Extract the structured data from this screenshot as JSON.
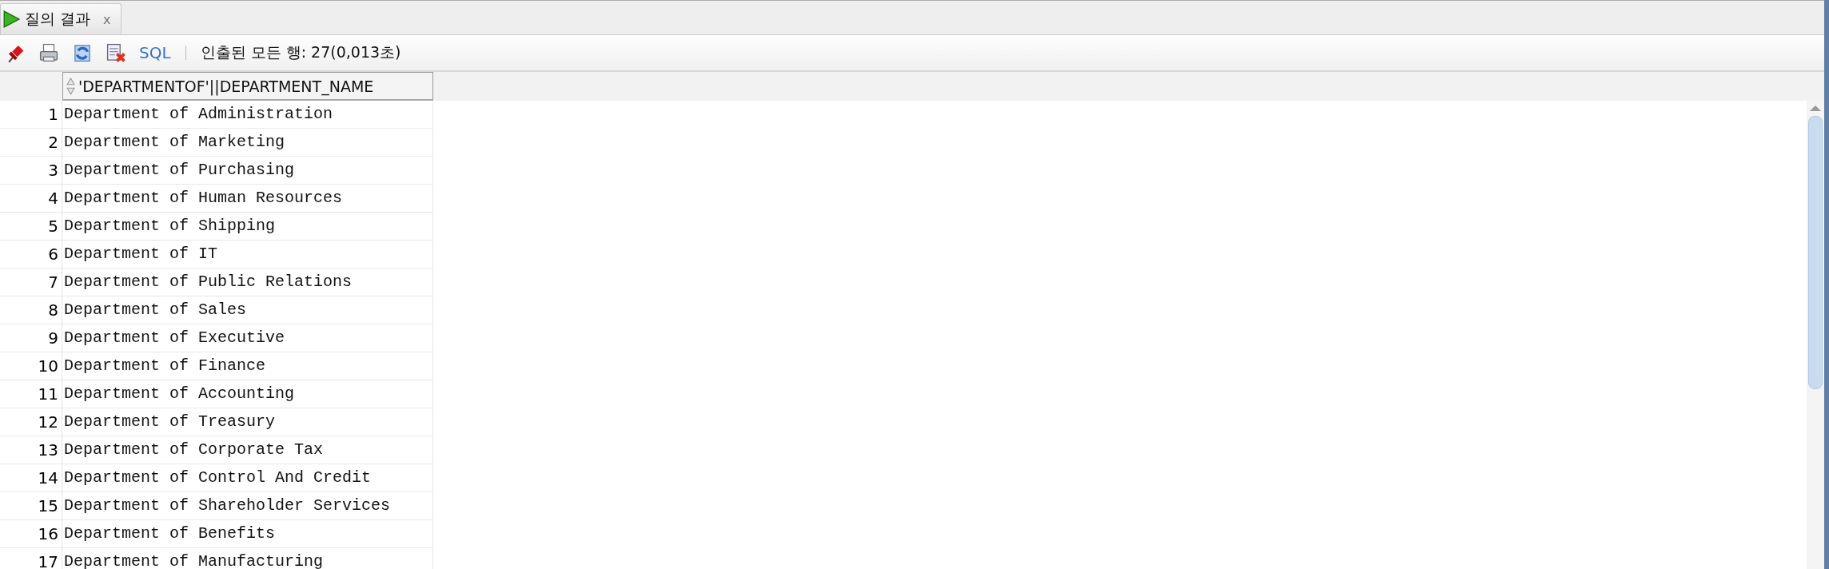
{
  "tabs": [
    {
      "label": "질의 결과",
      "close": "x",
      "selected": true
    }
  ],
  "toolbar": {
    "sql_link": "SQL",
    "status": "인출된 모든 행: 27(0,013초)"
  },
  "table": {
    "columns": [
      "'DEPARTMENTOF'||DEPARTMENT_NAME"
    ],
    "rows": [
      {
        "row_number": "1",
        "value": "Department of Administration"
      },
      {
        "row_number": "2",
        "value": "Department of Marketing"
      },
      {
        "row_number": "3",
        "value": "Department of Purchasing"
      },
      {
        "row_number": "4",
        "value": "Department of Human Resources"
      },
      {
        "row_number": "5",
        "value": "Department of Shipping"
      },
      {
        "row_number": "6",
        "value": "Department of IT"
      },
      {
        "row_number": "7",
        "value": "Department of Public Relations"
      },
      {
        "row_number": "8",
        "value": "Department of Sales"
      },
      {
        "row_number": "9",
        "value": "Department of Executive"
      },
      {
        "row_number": "10",
        "value": "Department of Finance"
      },
      {
        "row_number": "11",
        "value": "Department of Accounting"
      },
      {
        "row_number": "12",
        "value": "Department of Treasury"
      },
      {
        "row_number": "13",
        "value": "Department of Corporate Tax"
      },
      {
        "row_number": "14",
        "value": "Department of Control And Credit"
      },
      {
        "row_number": "15",
        "value": "Department of Shareholder Services"
      },
      {
        "row_number": "16",
        "value": "Department of Benefits"
      },
      {
        "row_number": "17",
        "value": "Department of Manufacturing"
      }
    ]
  }
}
